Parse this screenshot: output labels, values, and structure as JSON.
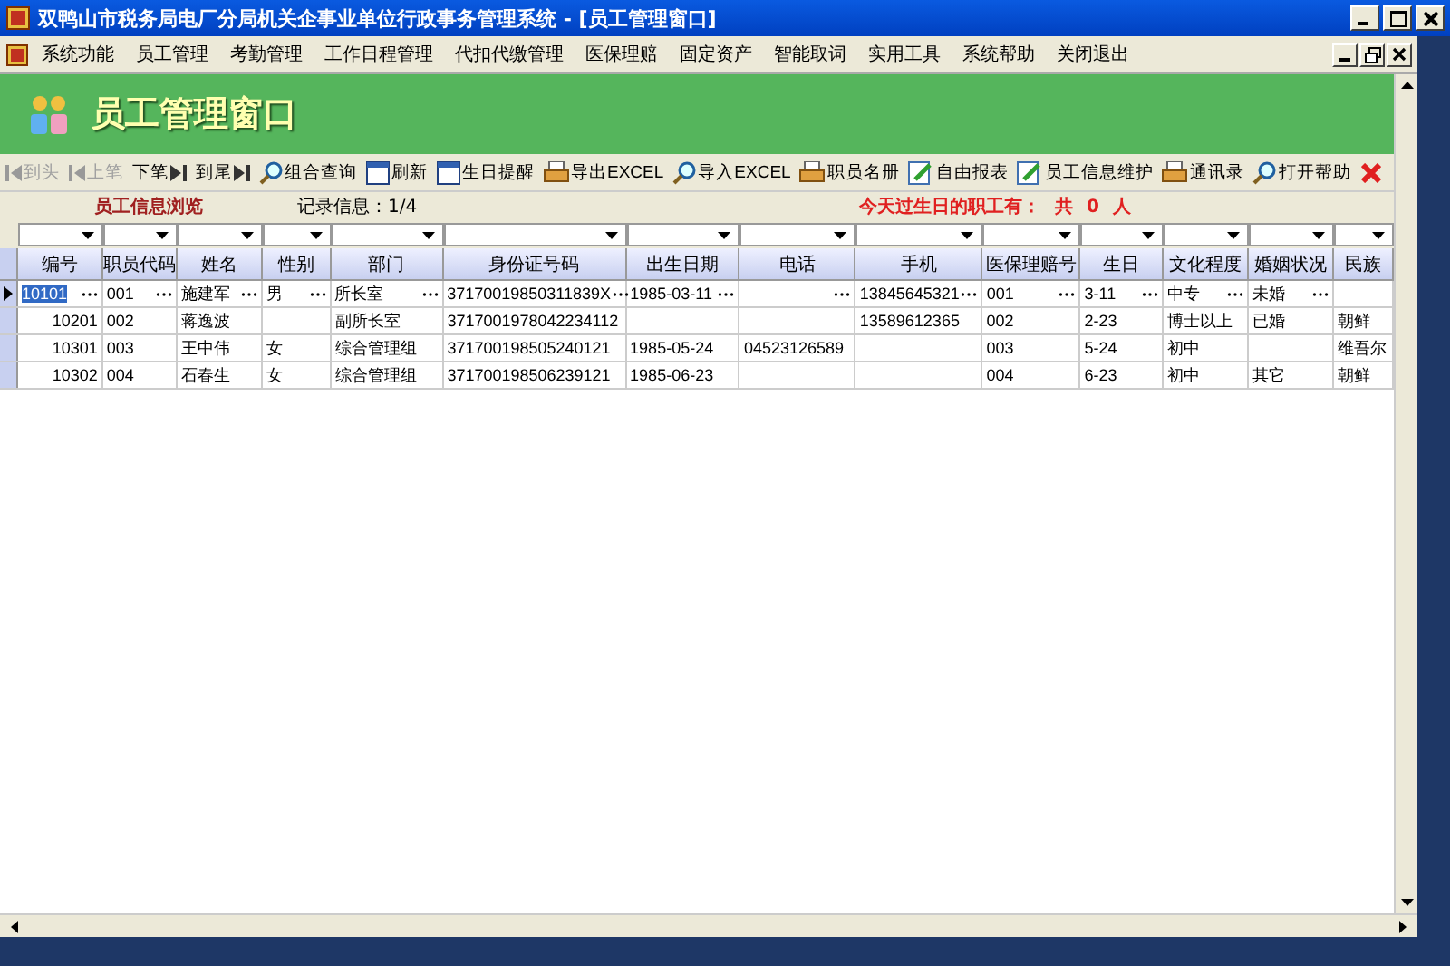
{
  "window": {
    "title": "双鸭山市税务局电厂分局机关企事业单位行政事务管理系统 - [员工管理窗口]"
  },
  "menu": [
    "系统功能",
    "员工管理",
    "考勤管理",
    "工作日程管理",
    "代扣代缴管理",
    "医保理赔",
    "固定资产",
    "智能取词",
    "实用工具",
    "系统帮助",
    "关闭退出"
  ],
  "header": {
    "title": "员工管理窗口"
  },
  "toolbar": [
    {
      "label": "到头",
      "disabled": true
    },
    {
      "label": "上笔",
      "disabled": true
    },
    {
      "label": "下笔",
      "disabled": false
    },
    {
      "label": "到尾",
      "disabled": false
    },
    {
      "label": "组合查询",
      "disabled": false
    },
    {
      "label": "刷新",
      "disabled": false
    },
    {
      "label": "生日提醒",
      "disabled": false
    },
    {
      "label": "导出EXCEL",
      "disabled": false
    },
    {
      "label": "导入EXCEL",
      "disabled": false
    },
    {
      "label": "职员名册",
      "disabled": false
    },
    {
      "label": "自由报表",
      "disabled": false
    },
    {
      "label": "员工信息维护",
      "disabled": false
    },
    {
      "label": "通讯录",
      "disabled": false
    },
    {
      "label": "打开帮助",
      "disabled": false
    }
  ],
  "info": {
    "section_title": "员工信息浏览",
    "record_info": "记录信息：1/4",
    "birthday_label": "今天过生日的职工有：",
    "birthday_count": "共 0 人"
  },
  "table": {
    "columns": [
      "编号",
      "职员代码",
      "姓名",
      "性别",
      "部门",
      "身份证号码",
      "出生日期",
      "电话",
      "手机",
      "医保理赔号",
      "生日",
      "文化程度",
      "婚姻状况",
      "民族"
    ],
    "rows": [
      {
        "selected": true,
        "cells": [
          "10101",
          "001",
          "施建军",
          "男",
          "所长室",
          "37170019850311839X",
          "1985-03-11",
          "",
          "13845645321",
          "001",
          "3-11",
          "中专",
          "未婚",
          ""
        ]
      },
      {
        "selected": false,
        "cells": [
          "10201",
          "002",
          "蒋逸波",
          "",
          "副所长室",
          "3717001978042234112",
          "",
          "",
          "13589612365",
          "002",
          "2-23",
          "博士以上",
          "已婚",
          "朝鲜"
        ]
      },
      {
        "selected": false,
        "cells": [
          "10301",
          "003",
          "王中伟",
          "女",
          "综合管理组",
          "371700198505240121",
          "1985-05-24",
          "04523126589",
          "",
          "003",
          "5-24",
          "初中",
          "",
          "维吾尔"
        ]
      },
      {
        "selected": false,
        "cells": [
          "10302",
          "004",
          "石春生",
          "女",
          "综合管理组",
          "371700198506239121",
          "1985-06-23",
          "",
          "",
          "004",
          "6-23",
          "初中",
          "其它",
          "朝鲜"
        ]
      }
    ]
  }
}
